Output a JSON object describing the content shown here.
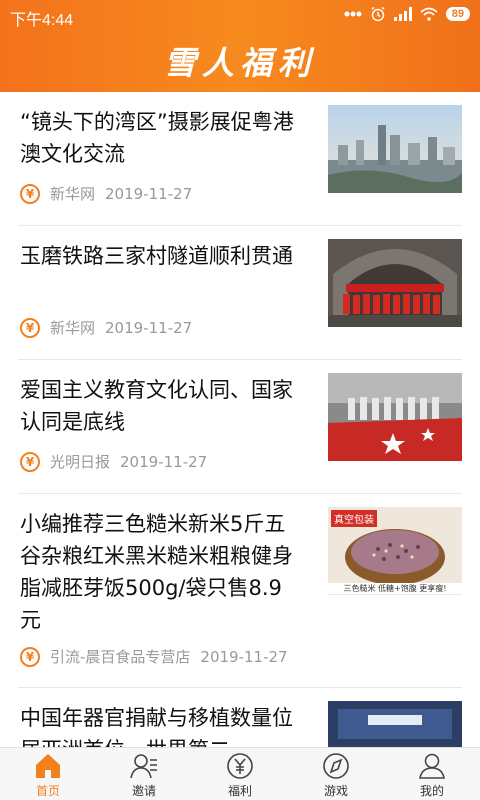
{
  "status": {
    "time": "下午4:44",
    "battery": "89"
  },
  "app": {
    "title": "雪人福利"
  },
  "feed": {
    "items": [
      {
        "title": "“镜头下的湾区”摄影展促粤港澳文化交流",
        "source": "新华网",
        "date": "2019-11-27",
        "thumb": "city-skyline-photo"
      },
      {
        "title": "玉磨铁路三家村隧道顺利贯通",
        "source": "新华网",
        "date": "2019-11-27",
        "thumb": "tunnel-workers-photo"
      },
      {
        "title": "爱国主义教育文化认同、国家认同是底线",
        "source": "光明日报",
        "date": "2019-11-27",
        "thumb": "flag-ceremony-photo"
      },
      {
        "title": "小编推荐三色糙米新米5斤五谷杂粮红米黑米糙米粗粮健身脂减胚芽饭500g/袋只售8.9元",
        "source": "引流-晨百食品专营店",
        "date": "2019-11-27",
        "thumb": "rice-product-photo",
        "badge": "真空包装",
        "caption": "三色糙米 低糖+饱腹 更享瘦!"
      },
      {
        "title": "中国年器官捐献与移植数量位居亚洲首位，世界第二",
        "source": "",
        "date": "",
        "thumb": "conference-photo"
      }
    ]
  },
  "tabbar": {
    "tabs": [
      {
        "label": "首页",
        "icon": "home-icon",
        "active": true
      },
      {
        "label": "邀请",
        "icon": "invite-user-icon"
      },
      {
        "label": "福利",
        "icon": "yuan-coin-icon"
      },
      {
        "label": "游戏",
        "icon": "compass-icon"
      },
      {
        "label": "我的",
        "icon": "profile-icon"
      }
    ]
  },
  "colors": {
    "accent": "#f2801f",
    "header_start": "#f4721c",
    "header_end": "#f0701a"
  }
}
